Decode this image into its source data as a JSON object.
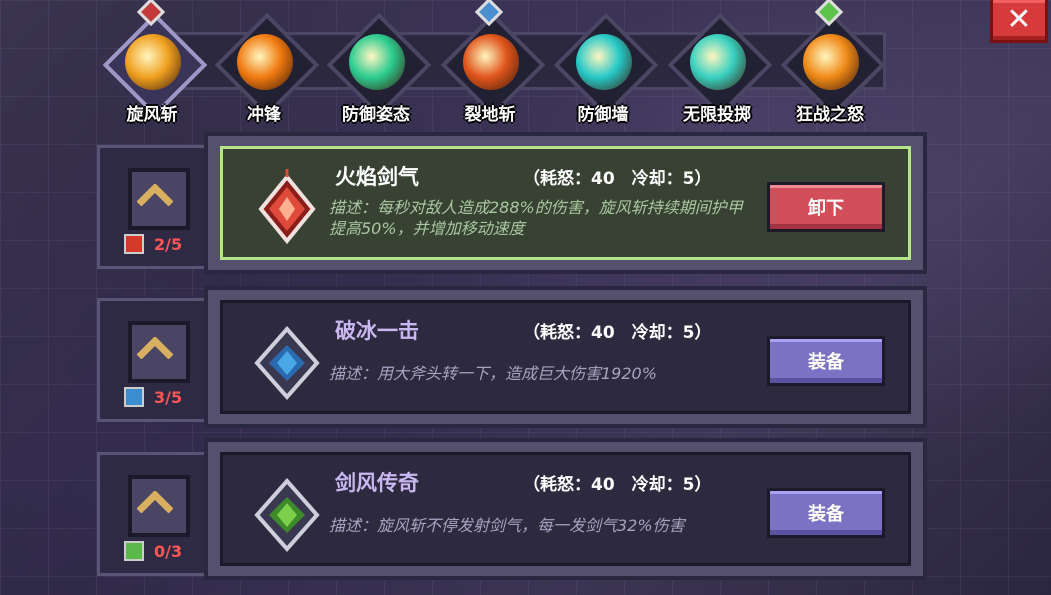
{
  "close_label": "✕",
  "tabs": [
    {
      "label": "旋风斩",
      "icon": "whirlwind-icon",
      "color": "#f0a020",
      "active": true,
      "gem": "red"
    },
    {
      "label": "冲锋",
      "icon": "charge-icon",
      "color": "#f07a10",
      "active": false,
      "gem": null
    },
    {
      "label": "防御姿态",
      "icon": "defense-stance-icon",
      "color": "#2ccc90",
      "active": false,
      "gem": null
    },
    {
      "label": "裂地斩",
      "icon": "ground-slam-icon",
      "color": "#e0551c",
      "active": false,
      "gem": "blue"
    },
    {
      "label": "防御墙",
      "icon": "defense-wall-icon",
      "color": "#26c8c8",
      "active": false,
      "gem": null
    },
    {
      "label": "无限投掷",
      "icon": "infinite-throw-icon",
      "color": "#38d0c0",
      "active": false,
      "gem": null
    },
    {
      "label": "狂战之怒",
      "icon": "berserker-rage-icon",
      "color": "#f08a18",
      "active": false,
      "gem": "green"
    }
  ],
  "runes": [
    {
      "name": "火焰剑气",
      "stats": "（耗怒：40　冷却：5）",
      "desc": "描述：每秒对敌人造成288%的伤害，旋风斩持续期间护甲提高50%，并增加移动速度",
      "button": "卸下",
      "button_type": "unequip",
      "level": "2/5",
      "icon": "fire-rune-icon",
      "gem_color": "#e04a3a",
      "selected": true
    },
    {
      "name": "破冰一击",
      "stats": "（耗怒：40　冷却：5）",
      "desc": "描述：用大斧头转一下，造成巨大伤害1920%",
      "button": "装备",
      "button_type": "equip",
      "level": "3/5",
      "icon": "ice-rune-icon",
      "gem_color": "#4aa8e8",
      "selected": false
    },
    {
      "name": "剑风传奇",
      "stats": "（耗怒：40　冷却：5）",
      "desc": "描述：旋风斩不停发射剑气，每一发剑气32%伤害",
      "button": "装备",
      "button_type": "equip",
      "level": "0/3",
      "icon": "wind-rune-icon",
      "gem_color": "#7ad04a",
      "selected": false
    }
  ]
}
